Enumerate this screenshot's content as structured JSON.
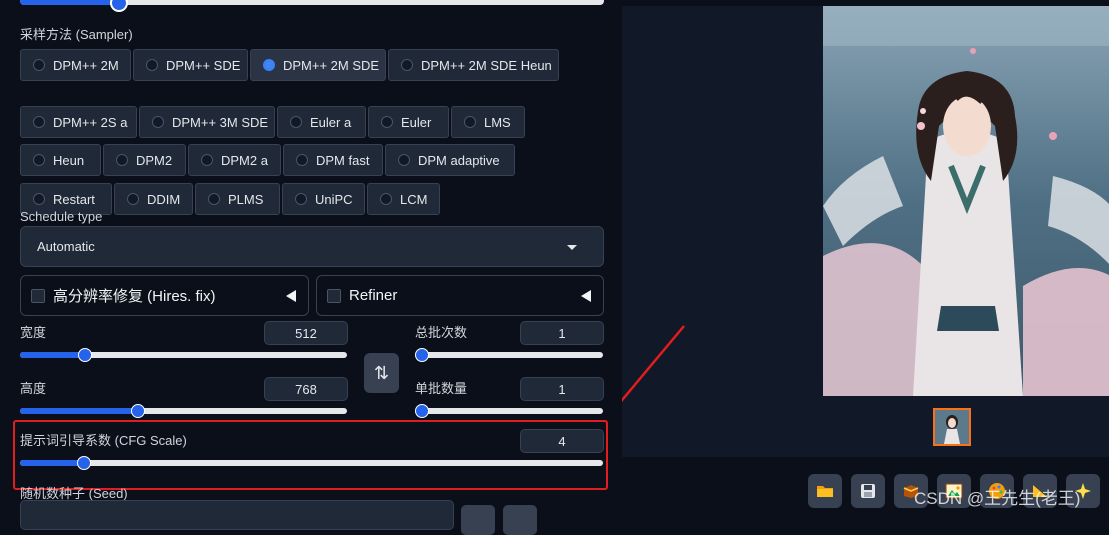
{
  "sampler": {
    "title": "采样方法 (Sampler)",
    "selected": "DPM++ 2M SDE",
    "options": [
      "DPM++ 2M",
      "DPM++ SDE",
      "DPM++ 2M SDE",
      "DPM++ 2M SDE Heun",
      "DPM++ 2S a",
      "DPM++ 3M SDE",
      "Euler a",
      "Euler",
      "LMS",
      "Heun",
      "DPM2",
      "DPM2 a",
      "DPM fast",
      "DPM adaptive",
      "Restart",
      "DDIM",
      "PLMS",
      "UniPC",
      "LCM"
    ]
  },
  "top_slider": {
    "fraction": 0.17
  },
  "schedule": {
    "title": "Schedule type",
    "value": "Automatic"
  },
  "hires": {
    "label": "高分辨率修复 (Hires. fix)"
  },
  "refiner": {
    "label": "Refiner"
  },
  "width": {
    "label": "宽度",
    "value": "512",
    "fraction": 0.2
  },
  "height": {
    "label": "高度",
    "value": "768",
    "fraction": 0.36
  },
  "batch_count": {
    "label": "总批次数",
    "value": "1",
    "fraction": 0.0
  },
  "batch_size": {
    "label": "单批数量",
    "value": "1",
    "fraction": 0.0
  },
  "cfg": {
    "label": "提示词引导系数 (CFG Scale)",
    "value": "4",
    "fraction": 0.11
  },
  "seed": {
    "label": "随机数种子 (Seed)"
  },
  "toolbar": {
    "icons": [
      "folder-icon",
      "save-icon",
      "zip-icon",
      "image-icon",
      "palette-icon",
      "triangle-ruler-icon",
      "sparkle-icon"
    ]
  },
  "watermark": "CSDN @王先生(老王)",
  "colors": {
    "accent": "#2563eb",
    "highlight": "#e11d1d",
    "thumb_border": "#f97316"
  }
}
